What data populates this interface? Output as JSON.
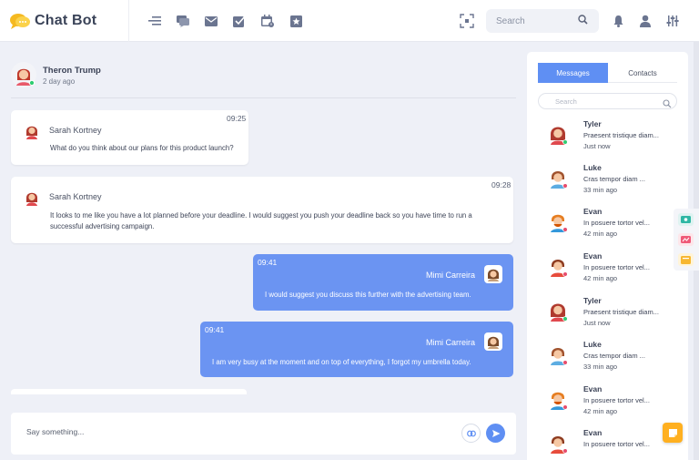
{
  "app": {
    "name": "Chat Bot"
  },
  "header": {
    "search_placeholder": "Search",
    "nav_icons": [
      "menu-toggle-icon",
      "chat-icon",
      "mail-icon",
      "inbox-check-icon",
      "calendar-icon",
      "star-icon"
    ],
    "right_icons": [
      "bell-icon",
      "user-icon",
      "settings-sliders-icon"
    ]
  },
  "conversation": {
    "contact_name": "Theron Trump",
    "last_seen": "2 day ago",
    "messages": [
      {
        "direction": "in",
        "time": "09:25",
        "sender": "Sarah Kortney",
        "text": "What do you think about our plans for this product launch?"
      },
      {
        "direction": "in",
        "time": "09:28",
        "sender": "Sarah Kortney",
        "text_line1": "It looks to me like you have a lot planned before your deadline. I would suggest you push your deadline back so you have time to run a",
        "text_line2": "successful advertising campaign."
      },
      {
        "direction": "out",
        "time": "09:41",
        "sender": "Mimi Carreira",
        "text": "I would suggest you discuss this further with the advertising team."
      },
      {
        "direction": "out",
        "time": "09:41",
        "sender": "Mimi Carreira",
        "text": "I am very busy at the moment and on top of everything, I forgot my umbrella today."
      }
    ]
  },
  "composer": {
    "placeholder": "Say something..."
  },
  "sidebar": {
    "tabs": [
      {
        "label": "Messages",
        "active": true
      },
      {
        "label": "Contacts",
        "active": false
      }
    ],
    "search_placeholder": "Search",
    "contacts": [
      {
        "name": "Tyler",
        "preview": "Praesent tristique diam...",
        "ago": "Just now",
        "status": "online"
      },
      {
        "name": "Luke",
        "preview": "Cras tempor diam ...",
        "ago": "33 min ago",
        "status": "offline"
      },
      {
        "name": "Evan",
        "preview": "In posuere tortor vel...",
        "ago": "42 min ago",
        "status": "offline"
      },
      {
        "name": "Evan",
        "preview": "In posuere tortor vel...",
        "ago": "42 min ago",
        "status": "offline"
      },
      {
        "name": "Tyler",
        "preview": "Praesent tristique diam...",
        "ago": "Just now",
        "status": "online"
      },
      {
        "name": "Luke",
        "preview": "Cras tempor diam ...",
        "ago": "33 min ago",
        "status": "offline"
      },
      {
        "name": "Evan",
        "preview": "In posuere tortor vel...",
        "ago": "42 min ago",
        "status": "offline"
      },
      {
        "name": "Evan",
        "preview": "In posuere tortor vel...",
        "ago": "",
        "status": "offline"
      }
    ]
  },
  "colors": {
    "accent": "#5f8ff3",
    "outgoing_bubble": "#6b94f2",
    "online": "#2ecc71",
    "offline": "#e74c6c",
    "fab": "#ffb020"
  }
}
